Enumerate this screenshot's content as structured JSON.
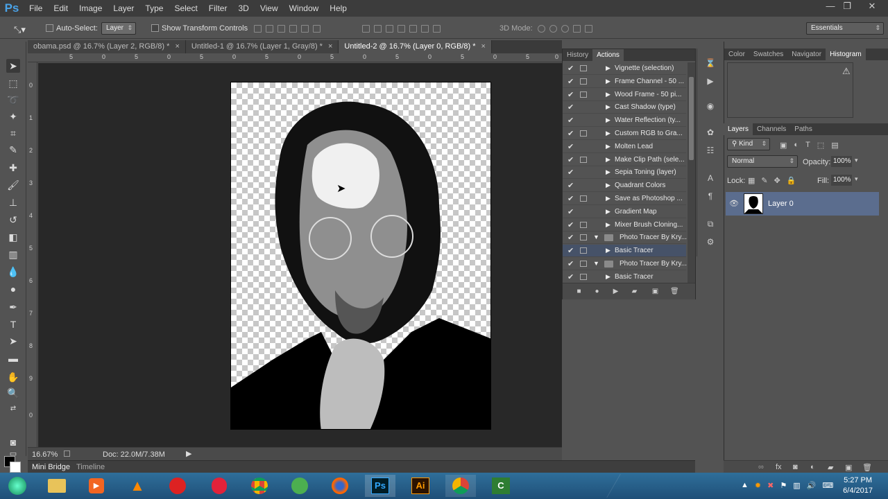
{
  "app": {
    "logo": "Ps"
  },
  "menu": [
    "File",
    "Edit",
    "Image",
    "Layer",
    "Type",
    "Select",
    "Filter",
    "3D",
    "View",
    "Window",
    "Help"
  ],
  "window_controls": {
    "minimize": "—",
    "restore": "❐",
    "close": "✕"
  },
  "options": {
    "auto_select_label": "Auto-Select:",
    "auto_select_value": "Layer",
    "show_transform": "Show Transform Controls",
    "mode_3d": "3D Mode:",
    "workspace": "Essentials"
  },
  "doc_tabs": [
    {
      "label": "obama.psd @ 16.7% (Layer 2, RGB/8) *",
      "close": "×"
    },
    {
      "label": "Untitled-1 @ 16.7% (Layer 1, Gray/8) *",
      "close": "×"
    },
    {
      "label": "Untitled-2 @ 16.7% (Layer 0, RGB/8) *",
      "close": "×"
    }
  ],
  "ruler_h": [
    "5",
    "0",
    "5",
    "0",
    "5",
    "0",
    "5",
    "0",
    "5",
    "0",
    "5",
    "0",
    "5",
    "0",
    "5",
    "0"
  ],
  "ruler_v": [
    "0",
    "1",
    "2",
    "3",
    "4",
    "5",
    "6",
    "7",
    "8",
    "9",
    "0"
  ],
  "status": {
    "zoom": "16.67%",
    "doc": "Doc: 22.0M/7.38M"
  },
  "bottom_tabs": {
    "mini_bridge": "Mini Bridge",
    "timeline": "Timeline"
  },
  "actions_panel": {
    "tabs": [
      "History",
      "Actions"
    ],
    "items": [
      {
        "label": "Vignette (selection)",
        "dialog": true,
        "type": "action"
      },
      {
        "label": "Frame Channel - 50 ...",
        "dialog": true,
        "type": "action"
      },
      {
        "label": "Wood Frame - 50 pi...",
        "dialog": true,
        "type": "action"
      },
      {
        "label": "Cast Shadow (type)",
        "dialog": false,
        "type": "action"
      },
      {
        "label": "Water Reflection (ty...",
        "dialog": false,
        "type": "action"
      },
      {
        "label": "Custom RGB to Gra...",
        "dialog": true,
        "type": "action"
      },
      {
        "label": "Molten Lead",
        "dialog": false,
        "type": "action"
      },
      {
        "label": "Make Clip Path (sele...",
        "dialog": true,
        "type": "action"
      },
      {
        "label": "Sepia Toning (layer)",
        "dialog": false,
        "type": "action"
      },
      {
        "label": "Quadrant Colors",
        "dialog": false,
        "type": "action"
      },
      {
        "label": "Save as Photoshop ...",
        "dialog": true,
        "type": "action"
      },
      {
        "label": "Gradient Map",
        "dialog": false,
        "type": "action"
      },
      {
        "label": "Mixer Brush Cloning...",
        "dialog": true,
        "type": "action"
      },
      {
        "label": "Photo Tracer By Kry...",
        "dialog": true,
        "type": "set"
      },
      {
        "label": "Basic Tracer",
        "dialog": true,
        "type": "action",
        "highlight": true
      },
      {
        "label": "Photo Tracer By Kry...",
        "dialog": true,
        "type": "set"
      },
      {
        "label": "Basic Tracer",
        "dialog": true,
        "type": "action"
      }
    ]
  },
  "right_panels": {
    "top_tabs": [
      "Color",
      "Swatches",
      "Navigator",
      "Histogram"
    ],
    "warning": "⚠",
    "layers_tabs": [
      "Layers",
      "Channels",
      "Paths"
    ],
    "kind": "Kind",
    "blend": "Normal",
    "opacity_label": "Opacity:",
    "opacity": "100%",
    "lock_label": "Lock:",
    "fill_label": "Fill:",
    "fill": "100%",
    "layer_name": "Layer 0"
  },
  "taskbar": {
    "time": "5:27 PM",
    "date": "6/4/2017",
    "ps": "Ps",
    "ai": "Ai"
  }
}
